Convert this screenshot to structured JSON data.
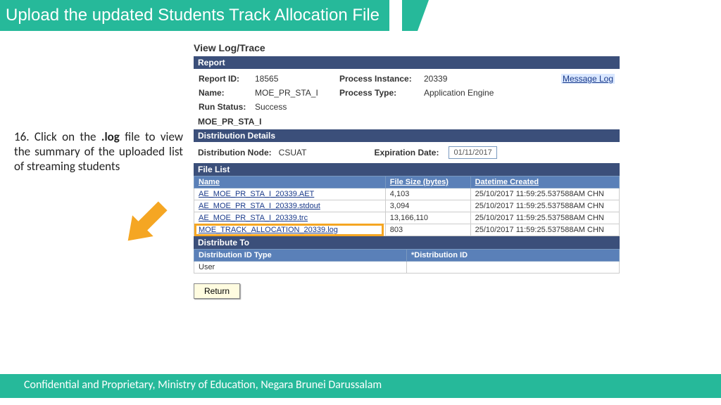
{
  "header": {
    "title": "Upload the updated Students Track Allocation File"
  },
  "instruction": {
    "text_prefix": "16. Click on the ",
    "text_bold": ".log",
    "text_suffix": " file to view the summary of the uploaded list of streaming students"
  },
  "panel": {
    "title": "View Log/Trace",
    "report_bar": "Report",
    "report_id_label": "Report ID:",
    "report_id": "18565",
    "process_instance_label": "Process Instance:",
    "process_instance": "20339",
    "message_log": "Message Log",
    "name_label": "Name:",
    "name": "MOE_PR_STA_I",
    "process_type_label": "Process Type:",
    "process_type": "Application Engine",
    "run_status_label": "Run Status:",
    "run_status": "Success",
    "sub_title": "MOE_PR_STA_I",
    "dist_bar": "Distribution Details",
    "dist_node_label": "Distribution Node:",
    "dist_node": "CSUAT",
    "exp_label": "Expiration Date:",
    "exp_value": "01/11/2017",
    "filelist_bar": "File List",
    "col_name": "Name",
    "col_size": "File Size (bytes)",
    "col_dt": "Datetime Created",
    "files": [
      {
        "name": "AE_MOE_PR_STA_I_20339.AET",
        "size": "4,103",
        "dt": "25/10/2017 11:59:25.537588AM CHN"
      },
      {
        "name": "AE_MOE_PR_STA_I_20339.stdout",
        "size": "3,094",
        "dt": "25/10/2017 11:59:25.537588AM CHN"
      },
      {
        "name": "AE_MOE_PR_STA_I_20339.trc",
        "size": "13,166,110",
        "dt": "25/10/2017 11:59:25.537588AM CHN"
      },
      {
        "name": "MOE_TRACK_ALLOCATION_20339.log",
        "size": "803",
        "dt": "25/10/2017 11:59:25.537588AM CHN"
      }
    ],
    "distto_bar": "Distribute To",
    "col_distidtype": "Distribution ID Type",
    "col_distid": "*Distribution ID",
    "distto_row": "User",
    "return_label": "Return"
  },
  "footer": {
    "text": "Confidential and Proprietary, Ministry of Education, Negara Brunei Darussalam"
  }
}
